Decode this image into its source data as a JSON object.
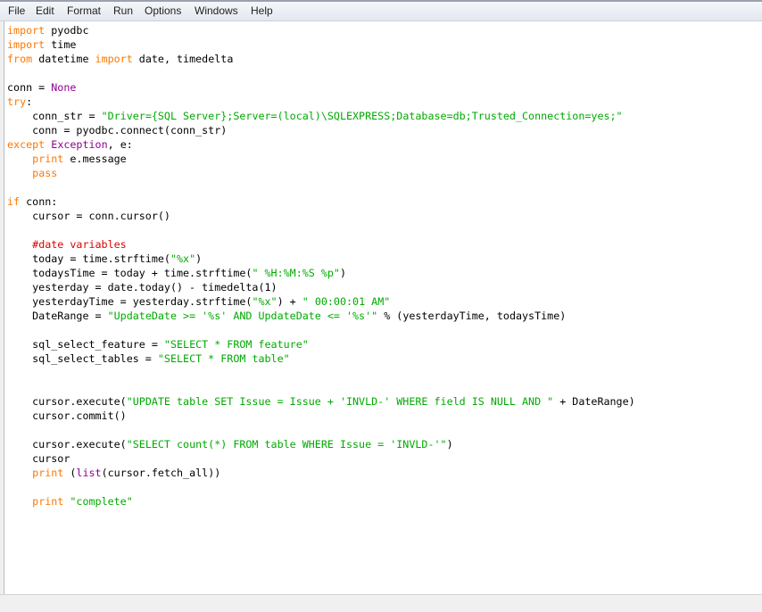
{
  "menu": {
    "file": "File",
    "edit": "Edit",
    "format": "Format",
    "run": "Run",
    "options": "Options",
    "windows": "Windows",
    "help": "Help"
  },
  "colors": {
    "keyword": "#ff7700",
    "builtin": "#900090",
    "string": "#00aa00",
    "comment": "#dd0000",
    "text": "#000000"
  },
  "code_lines": [
    [
      {
        "t": "import",
        "c": "kw"
      },
      {
        "t": " pyodbc",
        "c": ""
      }
    ],
    [
      {
        "t": "import",
        "c": "kw"
      },
      {
        "t": " time",
        "c": ""
      }
    ],
    [
      {
        "t": "from",
        "c": "kw"
      },
      {
        "t": " datetime ",
        "c": ""
      },
      {
        "t": "import",
        "c": "kw"
      },
      {
        "t": " date, timedelta",
        "c": ""
      }
    ],
    [],
    [
      {
        "t": "conn = ",
        "c": ""
      },
      {
        "t": "None",
        "c": "bi"
      }
    ],
    [
      {
        "t": "try",
        "c": "kw"
      },
      {
        "t": ":",
        "c": ""
      }
    ],
    [
      {
        "t": "    conn_str = ",
        "c": ""
      },
      {
        "t": "\"Driver={SQL Server};Server=(local)\\SQLEXPRESS;Database=db;Trusted_Connection=yes;\"",
        "c": "st"
      }
    ],
    [
      {
        "t": "    conn = pyodbc.connect(conn_str)",
        "c": ""
      }
    ],
    [
      {
        "t": "except",
        "c": "kw"
      },
      {
        "t": " ",
        "c": ""
      },
      {
        "t": "Exception",
        "c": "bi"
      },
      {
        "t": ", e:",
        "c": ""
      }
    ],
    [
      {
        "t": "    ",
        "c": ""
      },
      {
        "t": "print",
        "c": "kw"
      },
      {
        "t": " e.message",
        "c": ""
      }
    ],
    [
      {
        "t": "    ",
        "c": ""
      },
      {
        "t": "pass",
        "c": "kw"
      }
    ],
    [],
    [
      {
        "t": "if",
        "c": "kw"
      },
      {
        "t": " conn:",
        "c": ""
      }
    ],
    [
      {
        "t": "    cursor = conn.cursor()",
        "c": ""
      }
    ],
    [],
    [
      {
        "t": "    ",
        "c": ""
      },
      {
        "t": "#date variables",
        "c": "cm"
      }
    ],
    [
      {
        "t": "    today = time.strftime(",
        "c": ""
      },
      {
        "t": "\"%x\"",
        "c": "st"
      },
      {
        "t": ")",
        "c": ""
      }
    ],
    [
      {
        "t": "    todaysTime = today + time.strftime(",
        "c": ""
      },
      {
        "t": "\" %H:%M:%S %p\"",
        "c": "st"
      },
      {
        "t": ")",
        "c": ""
      }
    ],
    [
      {
        "t": "    yesterday = date.today() - timedelta(1)",
        "c": ""
      }
    ],
    [
      {
        "t": "    yesterdayTime = yesterday.strftime(",
        "c": ""
      },
      {
        "t": "\"%x\"",
        "c": "st"
      },
      {
        "t": ") + ",
        "c": ""
      },
      {
        "t": "\" 00:00:01 AM\"",
        "c": "st"
      }
    ],
    [
      {
        "t": "    DateRange = ",
        "c": ""
      },
      {
        "t": "\"UpdateDate >= '%s' AND UpdateDate <= '%s'\"",
        "c": "st"
      },
      {
        "t": " % (yesterdayTime, todaysTime)",
        "c": ""
      }
    ],
    [],
    [
      {
        "t": "    sql_select_feature = ",
        "c": ""
      },
      {
        "t": "\"SELECT * FROM feature\"",
        "c": "st"
      }
    ],
    [
      {
        "t": "    sql_select_tables = ",
        "c": ""
      },
      {
        "t": "\"SELECT * FROM table\"",
        "c": "st"
      }
    ],
    [],
    [],
    [
      {
        "t": "    cursor.execute(",
        "c": ""
      },
      {
        "t": "\"UPDATE table SET Issue = Issue + 'INVLD-' WHERE field IS NULL AND \"",
        "c": "st"
      },
      {
        "t": " + DateRange)",
        "c": ""
      }
    ],
    [
      {
        "t": "    cursor.commit()",
        "c": ""
      }
    ],
    [],
    [
      {
        "t": "    cursor.execute(",
        "c": ""
      },
      {
        "t": "\"SELECT count(*) FROM table WHERE Issue = 'INVLD-'\"",
        "c": "st"
      },
      {
        "t": ")",
        "c": ""
      }
    ],
    [
      {
        "t": "    cursor",
        "c": ""
      }
    ],
    [
      {
        "t": "    ",
        "c": ""
      },
      {
        "t": "print",
        "c": "kw"
      },
      {
        "t": " (",
        "c": ""
      },
      {
        "t": "list",
        "c": "bi"
      },
      {
        "t": "(cursor.fetch_all))",
        "c": ""
      }
    ],
    [],
    [
      {
        "t": "    ",
        "c": ""
      },
      {
        "t": "print",
        "c": "kw"
      },
      {
        "t": " ",
        "c": ""
      },
      {
        "t": "\"complete\"",
        "c": "st"
      }
    ]
  ]
}
